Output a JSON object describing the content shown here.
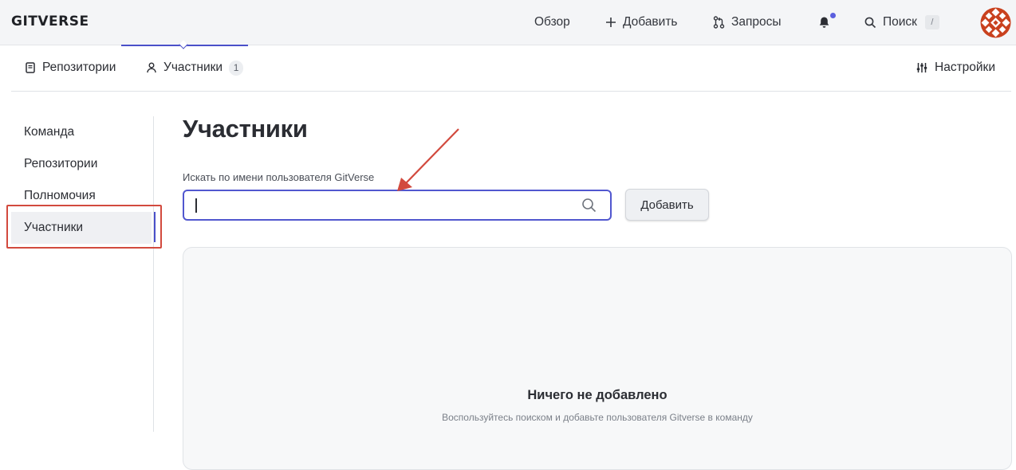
{
  "header": {
    "logo": "GITVERSE",
    "nav": {
      "overview": "Обзор",
      "add": "Добавить",
      "requests": "Запросы",
      "search": "Поиск",
      "search_shortcut": "/"
    }
  },
  "tabs": {
    "repositories": "Репозитории",
    "members": "Участники",
    "members_count": "1",
    "settings": "Настройки"
  },
  "sidebar": {
    "items": [
      {
        "label": "Команда"
      },
      {
        "label": "Репозитории"
      },
      {
        "label": "Полномочия"
      },
      {
        "label": "Участники"
      }
    ],
    "active_index": 3
  },
  "main": {
    "title": "Участники",
    "search_label": "Искать по имени пользователя GitVerse",
    "search_value": "",
    "add_button": "Добавить",
    "empty_title": "Ничего не добавлено",
    "empty_hint": "Воспользуйтесь поиском и добавьте пользователя Gitverse в команду"
  },
  "colors": {
    "accent": "#4a50c9",
    "annotation": "#d24a3e",
    "avatar": "#c9411e",
    "notification_dot": "#5b5fde"
  }
}
